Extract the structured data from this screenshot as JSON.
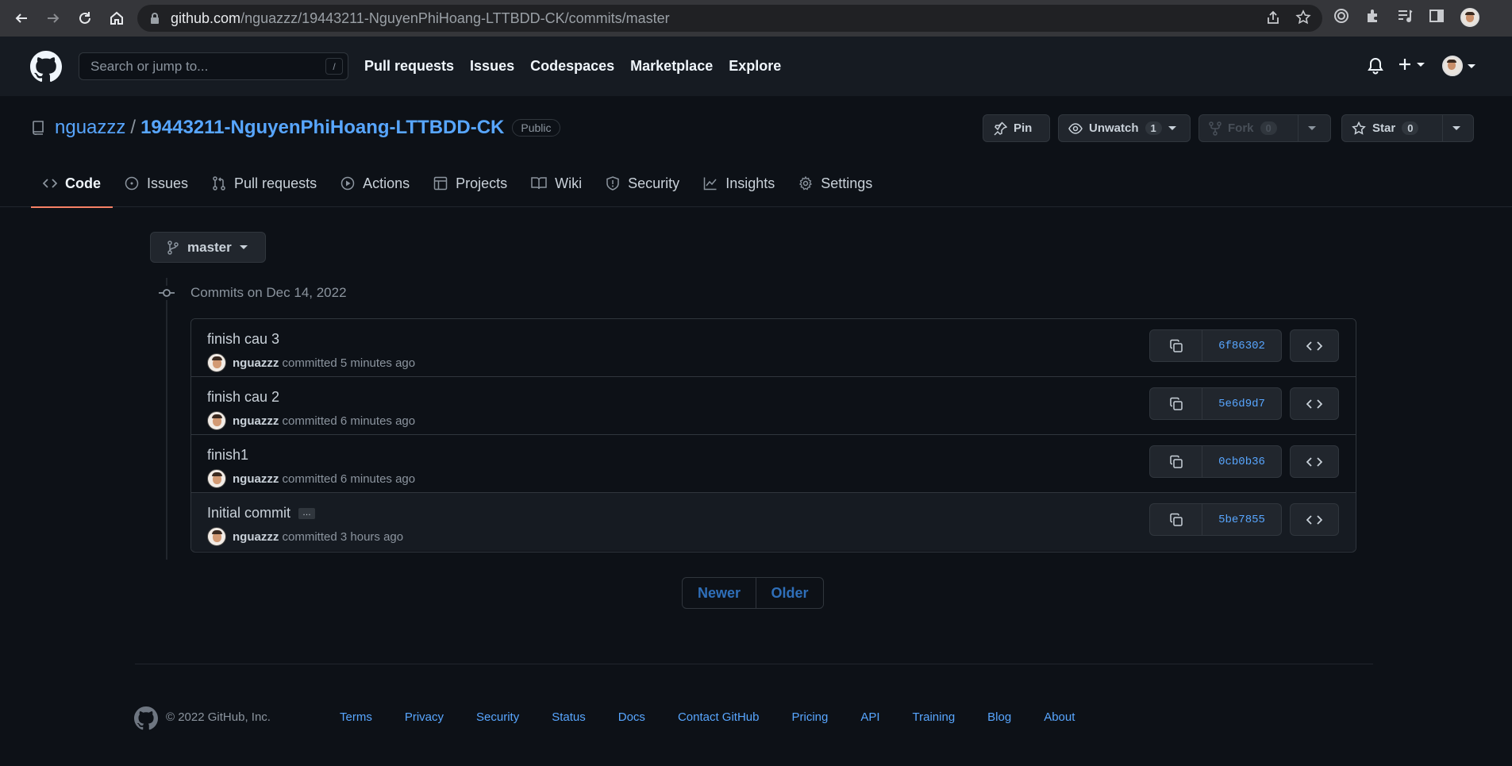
{
  "browser": {
    "url_host": "github.com",
    "url_path": "/nguazzz/19443211-NguyenPhiHoang-LTTBDD-CK/commits/master"
  },
  "header": {
    "search_placeholder": "Search or jump to...",
    "search_shortcut": "/",
    "nav": [
      "Pull requests",
      "Issues",
      "Codespaces",
      "Marketplace",
      "Explore"
    ]
  },
  "repo": {
    "owner": "nguazzz",
    "separator": "/",
    "name": "19443211-NguyenPhiHoang-LTTBDD-CK",
    "visibility": "Public",
    "pin_label": "Pin",
    "watch_label": "Unwatch",
    "watch_count": "1",
    "fork_label": "Fork",
    "fork_count": "0",
    "star_label": "Star",
    "star_count": "0"
  },
  "tabs": [
    {
      "label": "Code",
      "icon": "code-icon"
    },
    {
      "label": "Issues",
      "icon": "issue-icon"
    },
    {
      "label": "Pull requests",
      "icon": "pull-request-icon"
    },
    {
      "label": "Actions",
      "icon": "play-icon"
    },
    {
      "label": "Projects",
      "icon": "table-icon"
    },
    {
      "label": "Wiki",
      "icon": "book-icon"
    },
    {
      "label": "Security",
      "icon": "shield-icon"
    },
    {
      "label": "Insights",
      "icon": "graph-icon"
    },
    {
      "label": "Settings",
      "icon": "gear-icon"
    }
  ],
  "branch": "master",
  "commits_heading": "Commits on Dec 14, 2022",
  "commits": [
    {
      "message": "finish cau 3",
      "author": "nguazzz",
      "verb": "committed",
      "time": "5 minutes ago",
      "sha": "6f86302"
    },
    {
      "message": "finish cau 2",
      "author": "nguazzz",
      "verb": "committed",
      "time": "6 minutes ago",
      "sha": "5e6d9d7"
    },
    {
      "message": "finish1",
      "author": "nguazzz",
      "verb": "committed",
      "time": "6 minutes ago",
      "sha": "0cb0b36"
    },
    {
      "message": "Initial commit",
      "author": "nguazzz",
      "verb": "committed",
      "time": "3 hours ago",
      "sha": "5be7855",
      "ellipsis": "…"
    }
  ],
  "pager": {
    "newer": "Newer",
    "older": "Older"
  },
  "footer": {
    "copyright": "© 2022 GitHub, Inc.",
    "links": [
      "Terms",
      "Privacy",
      "Security",
      "Status",
      "Docs",
      "Contact GitHub",
      "Pricing",
      "API",
      "Training",
      "Blog",
      "About"
    ]
  }
}
